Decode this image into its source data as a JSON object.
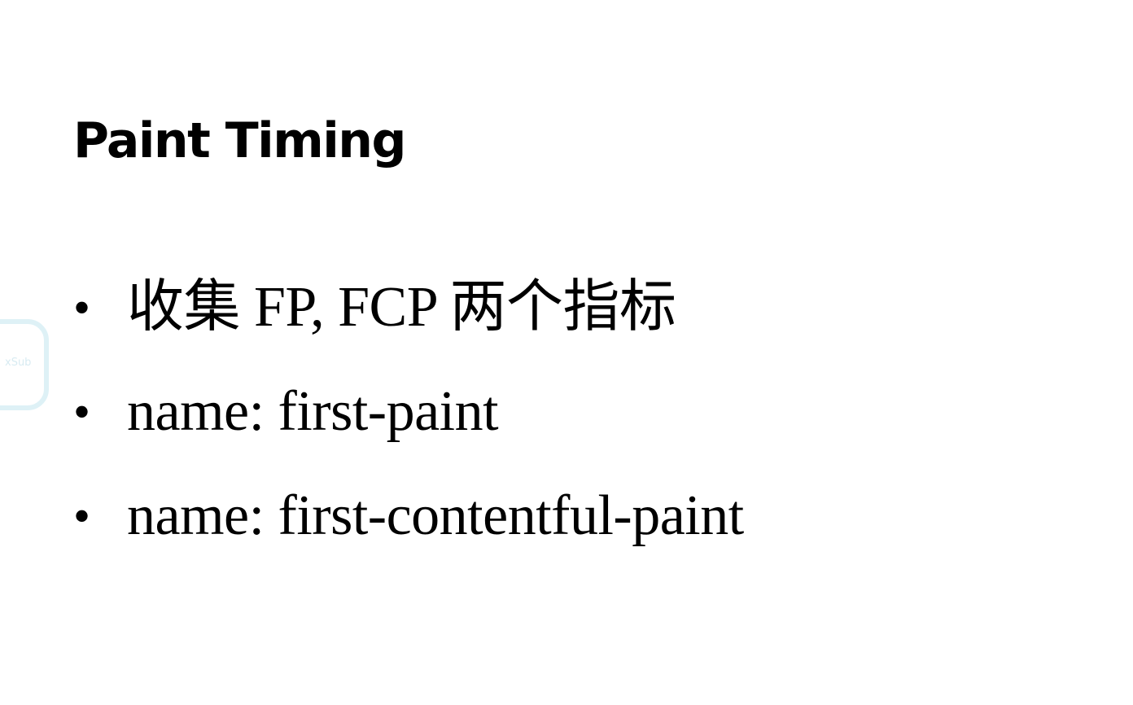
{
  "slide": {
    "title": "Paint Timing",
    "bullets": [
      {
        "marker": "•",
        "text": "收集 FP, FCP 两个指标"
      },
      {
        "marker": "•",
        "text": "name: first-paint"
      },
      {
        "marker": "•",
        "text": "name: first-contentful-paint"
      }
    ]
  },
  "watermark": {
    "text": "xSub"
  },
  "colors": {
    "background": "#ffffff",
    "text": "#000000",
    "watermark": "#d6eef5"
  }
}
